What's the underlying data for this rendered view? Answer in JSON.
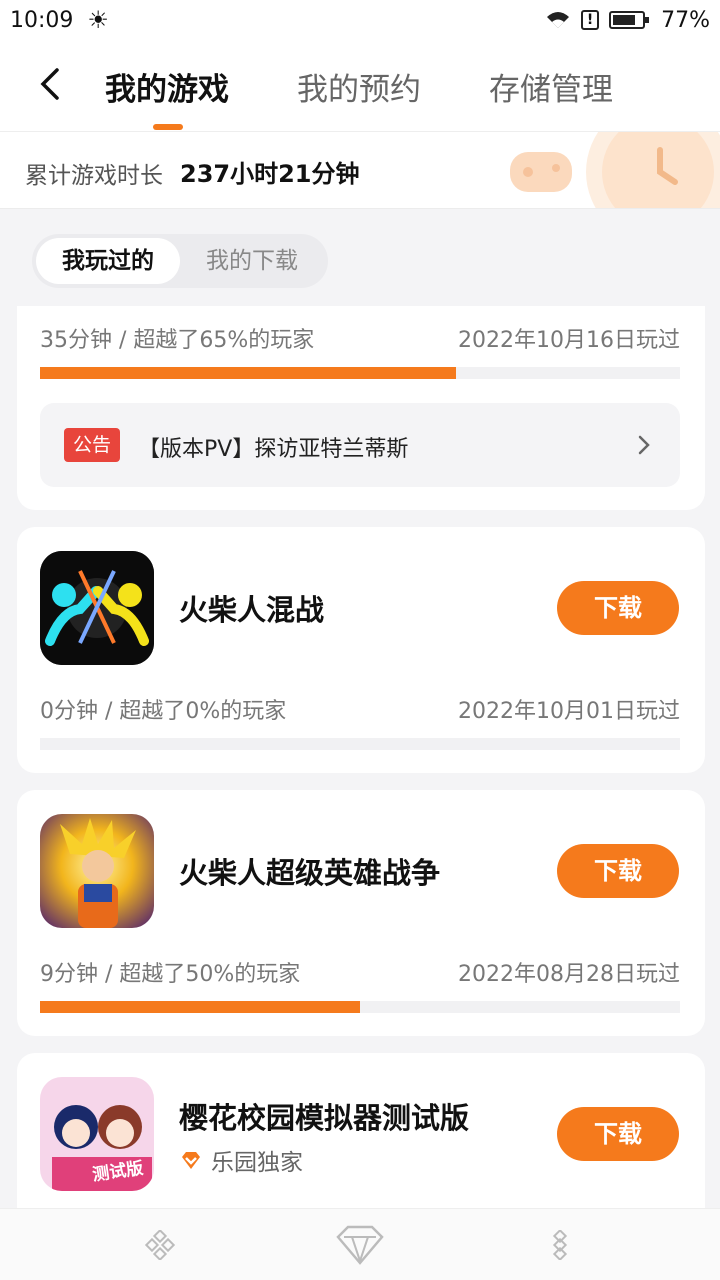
{
  "status_bar": {
    "time": "10:09",
    "weather_icon": "sun-icon",
    "battery": "77%"
  },
  "nav": {
    "tabs": [
      {
        "label": "我的游戏",
        "active": true
      },
      {
        "label": "我的预约",
        "active": false
      },
      {
        "label": "存储管理",
        "active": false
      }
    ]
  },
  "summary": {
    "label": "累计游戏时长",
    "value": "237小时21分钟"
  },
  "segment": {
    "items": [
      {
        "label": "我玩过的",
        "active": true
      },
      {
        "label": "我的下载",
        "active": false
      }
    ]
  },
  "first_card": {
    "stats": "35分钟 / 超越了65%的玩家",
    "date": "2022年10月16日玩过",
    "progress": 0.65,
    "notice": {
      "badge": "公告",
      "text": "【版本PV】探访亚特兰蒂斯"
    }
  },
  "games": [
    {
      "name": "火柴人混战",
      "button": "下载",
      "stats": "0分钟 / 超越了0%的玩家",
      "date": "2022年10月01日玩过",
      "progress": 0.0
    },
    {
      "name": "火柴人超级英雄战争",
      "button": "下载",
      "stats": "9分钟 / 超越了50%的玩家",
      "date": "2022年08月28日玩过",
      "progress": 0.5
    },
    {
      "name": "樱花校园模拟器测试版",
      "button": "下载",
      "exclusive": "乐园独家",
      "icon_text": "测试版"
    }
  ],
  "colors": {
    "accent": "#f57a1c",
    "badge": "#e8453c"
  }
}
